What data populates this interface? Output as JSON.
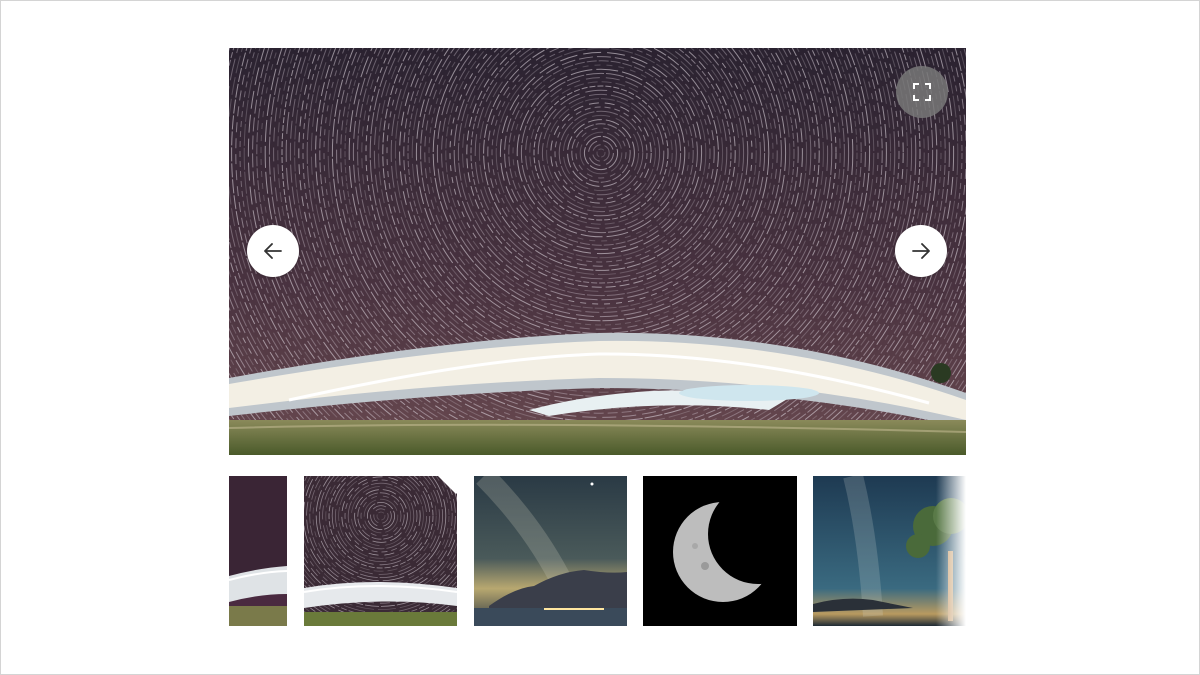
{
  "gallery": {
    "main_image": {
      "subject": "star-trails-over-building"
    },
    "controls": {
      "prev_icon": "arrow-left-icon",
      "next_icon": "arrow-right-icon",
      "fullscreen_icon": "fullscreen-icon"
    },
    "thumbnails": [
      {
        "subject": "star-trails-over-building",
        "state": "partial"
      },
      {
        "subject": "star-trails-over-building",
        "state": "active"
      },
      {
        "subject": "milky-way-over-mountains-and-lake",
        "state": "default"
      },
      {
        "subject": "crescent-moon",
        "state": "default"
      },
      {
        "subject": "milky-way-with-tree",
        "state": "faded"
      }
    ]
  },
  "colors": {
    "page_background": "#ffffff",
    "frame_border": "#d4d4d4",
    "button_background": "#ffffff",
    "fullscreen_button_background": "#787878",
    "icon_color": "#333333"
  }
}
